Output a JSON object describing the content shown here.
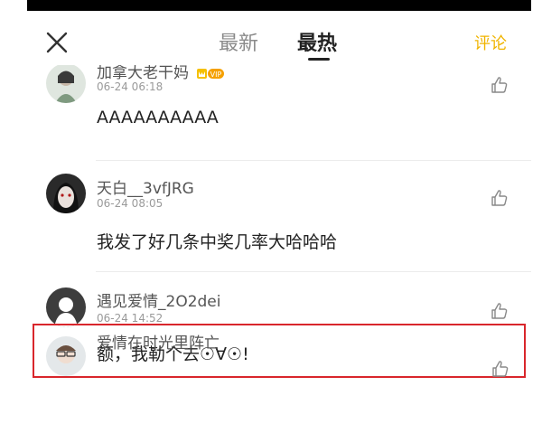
{
  "header": {
    "tabs": [
      {
        "label": "最新",
        "active": false
      },
      {
        "label": "最热",
        "active": true
      }
    ],
    "comment_link": "评论"
  },
  "comments": [
    {
      "username": "加拿大老干妈",
      "time": "06-24 06:18",
      "text": "AAAAAAAAAA",
      "vip_badge": "VIP"
    },
    {
      "username": "天白__3vfJRG",
      "time": "06-24 08:05",
      "text": "我发了好几条中奖几率大哈哈哈"
    },
    {
      "username": "遇见爱情_2O2dei",
      "time": "06-24 14:52",
      "text": "额，我勒个去☉∀☉!"
    },
    {
      "username": "爱情在时光里阵亡"
    }
  ],
  "colors": {
    "accent": "#f0b400",
    "highlight": "#d9262c"
  }
}
